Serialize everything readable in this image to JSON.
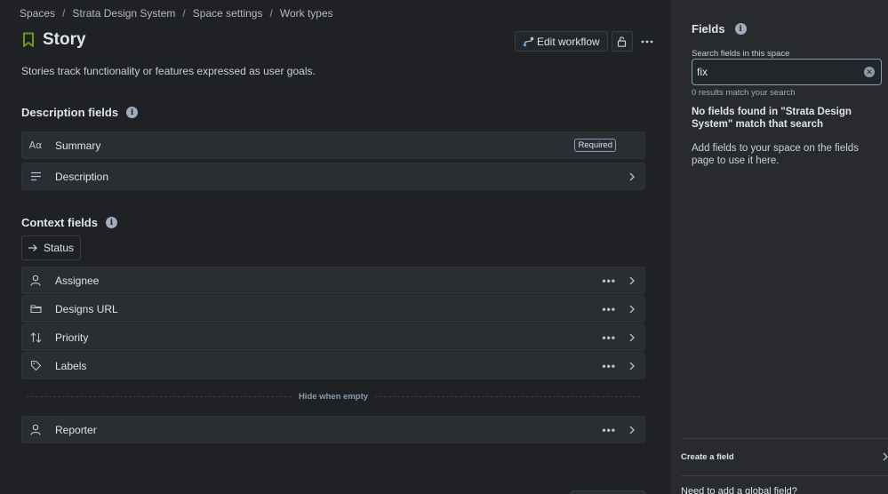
{
  "breadcrumb": [
    "Spaces",
    "Strata Design System",
    "Space settings",
    "Work types"
  ],
  "header": {
    "title": "Story",
    "description": "Stories track functionality or features expressed as user goals.",
    "edit_workflow_label": "Edit workflow"
  },
  "description_fields": {
    "heading": "Description fields",
    "items": [
      {
        "label": "Summary",
        "icon": "text-icon",
        "badge": "Required"
      },
      {
        "label": "Description",
        "icon": "lines-icon"
      }
    ]
  },
  "context_fields": {
    "heading": "Context fields",
    "status_label": "Status",
    "items": [
      {
        "label": "Assignee",
        "icon": "person-icon"
      },
      {
        "label": "Designs URL",
        "icon": "folder-icon"
      },
      {
        "label": "Priority",
        "icon": "sort-icon"
      },
      {
        "label": "Labels",
        "icon": "tag-icon"
      }
    ],
    "divider_label": "Hide when empty",
    "hidden_items": [
      {
        "label": "Reporter",
        "icon": "person-icon"
      }
    ]
  },
  "sidebar": {
    "heading": "Fields",
    "search_label": "Search fields in this space",
    "search_value": "fix",
    "results_text": "0 results match your search",
    "no_fields_text": "No fields found in \"Strata Design System\" match that search",
    "add_fields_text": "Add fields to your space on the fields page to use it here.",
    "create_field_label": "Create a field",
    "global_field_text": "Need to add a global field?"
  },
  "colors": {
    "accent_green": "#6a9a23",
    "background": "#1f2124",
    "sidebar_background": "#282a2e"
  }
}
